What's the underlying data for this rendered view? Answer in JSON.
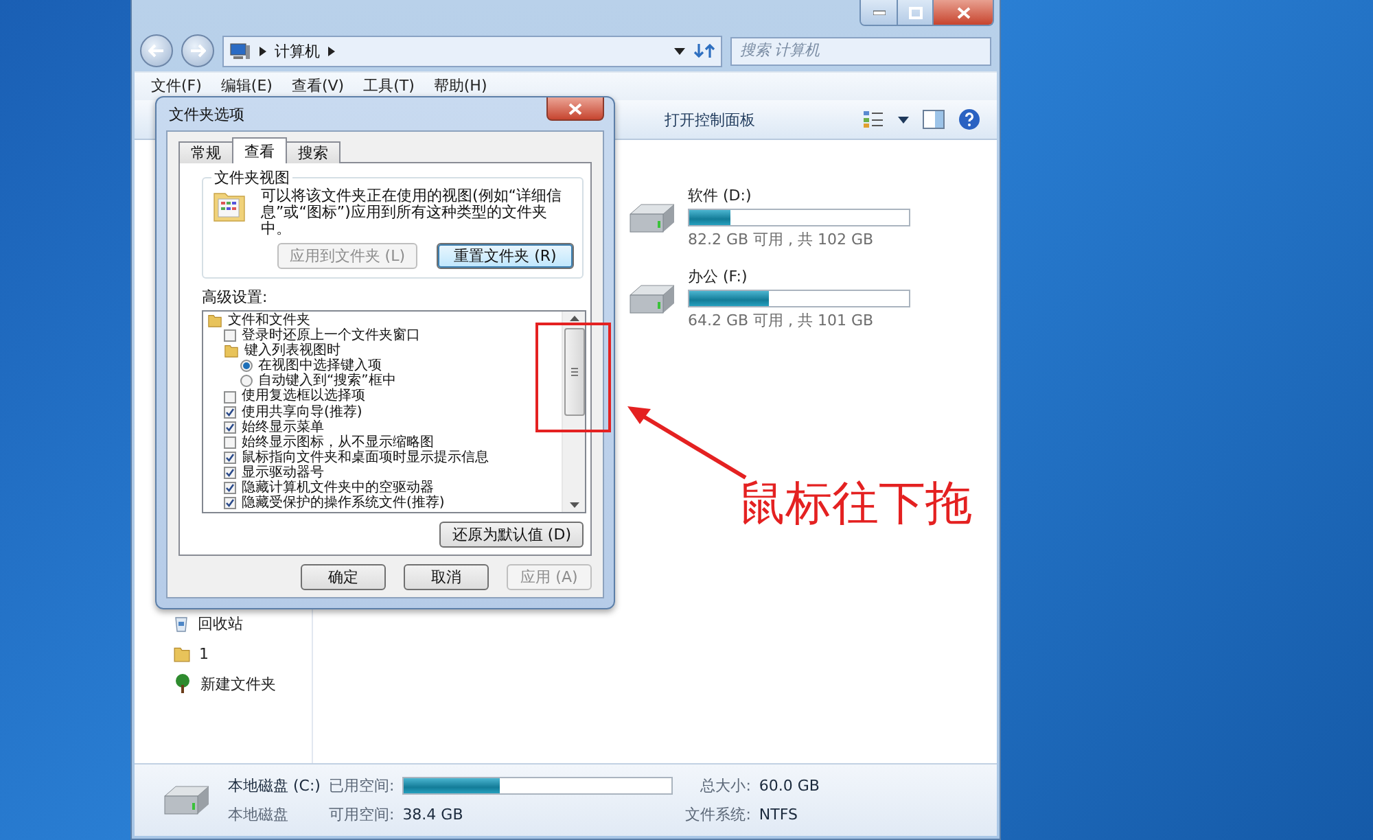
{
  "explorer": {
    "address": [
      "计算机"
    ],
    "search": {
      "placeholder": "搜索 计算机"
    },
    "menu": [
      "文件(F)",
      "编辑(E)",
      "查看(V)",
      "工具(T)",
      "帮助(H)"
    ],
    "toolbar": [
      "打开控制面板"
    ],
    "nav_items": [
      {
        "label": "回收站",
        "kind": "recycle"
      },
      {
        "label": "1",
        "kind": "folder"
      },
      {
        "label": "新建文件夹",
        "kind": "tree"
      }
    ],
    "drives": [
      {
        "name": "软件 (D:)",
        "level": 0.19,
        "space": "82.2 GB 可用 , 共 102 GB"
      },
      {
        "name": "办公 (F:)",
        "level": 0.36,
        "space": "64.2 GB 可用 , 共 101 GB"
      }
    ],
    "details": {
      "name": "本地磁盘 (C:)",
      "type": "本地磁盘",
      "used_label": "已用空间:",
      "level": 0.36,
      "free_label": "可用空间:",
      "free": "38.4 GB",
      "total_label": "总大小:",
      "total": "60.0 GB",
      "fs_label": "文件系统:",
      "fs": "NTFS"
    }
  },
  "dialog": {
    "title": "文件夹选项",
    "tabs": [
      {
        "label": "常规",
        "selected": false
      },
      {
        "label": "查看",
        "selected": true
      },
      {
        "label": "搜索",
        "selected": false
      }
    ],
    "folder_views": {
      "legend": "文件夹视图",
      "description": "可以将该文件夹正在使用的视图(例如“详细信息”或“图标”)应用到所有这种类型的文件夹中。",
      "buttons": [
        {
          "label": "应用到文件夹 (L)",
          "disabled": true
        },
        {
          "label": "重置文件夹 (R)",
          "disabled": false
        }
      ]
    },
    "advanced": {
      "label": "高级设置:",
      "restore_button": "还原为默认值 (D)",
      "tree": [
        {
          "kind": "folder",
          "label": "文件和文件夹",
          "children": [
            {
              "kind": "checkbox",
              "label": "登录时还原上一个文件夹窗口",
              "checked": false
            },
            {
              "kind": "folder",
              "label": "键入列表视图时",
              "children": [
                {
                  "kind": "radio",
                  "label": "在视图中选择键入项",
                  "selected": true
                },
                {
                  "kind": "radio",
                  "label": "自动键入到“搜索”框中",
                  "selected": false
                }
              ]
            },
            {
              "kind": "checkbox",
              "label": "使用复选框以选择项",
              "checked": false
            },
            {
              "kind": "checkbox",
              "label": "使用共享向导(推荐)",
              "checked": true
            },
            {
              "kind": "checkbox",
              "label": "始终显示菜单",
              "checked": true
            },
            {
              "kind": "checkbox",
              "label": "始终显示图标，从不显示缩略图",
              "checked": false
            },
            {
              "kind": "checkbox",
              "label": "鼠标指向文件夹和桌面项时显示提示信息",
              "checked": true
            },
            {
              "kind": "checkbox",
              "label": "显示驱动器号",
              "checked": true
            },
            {
              "kind": "checkbox",
              "label": "隐藏计算机文件夹中的空驱动器",
              "checked": true
            },
            {
              "kind": "checkbox",
              "label": "隐藏受保护的操作系统文件(推荐)",
              "checked": true
            }
          ]
        }
      ]
    },
    "buttons": [
      {
        "label": "确定",
        "disabled": false
      },
      {
        "label": "取消",
        "disabled": false
      },
      {
        "label": "应用 (A)",
        "disabled": true
      }
    ]
  },
  "annotation": {
    "text": "鼠标往下拖"
  }
}
